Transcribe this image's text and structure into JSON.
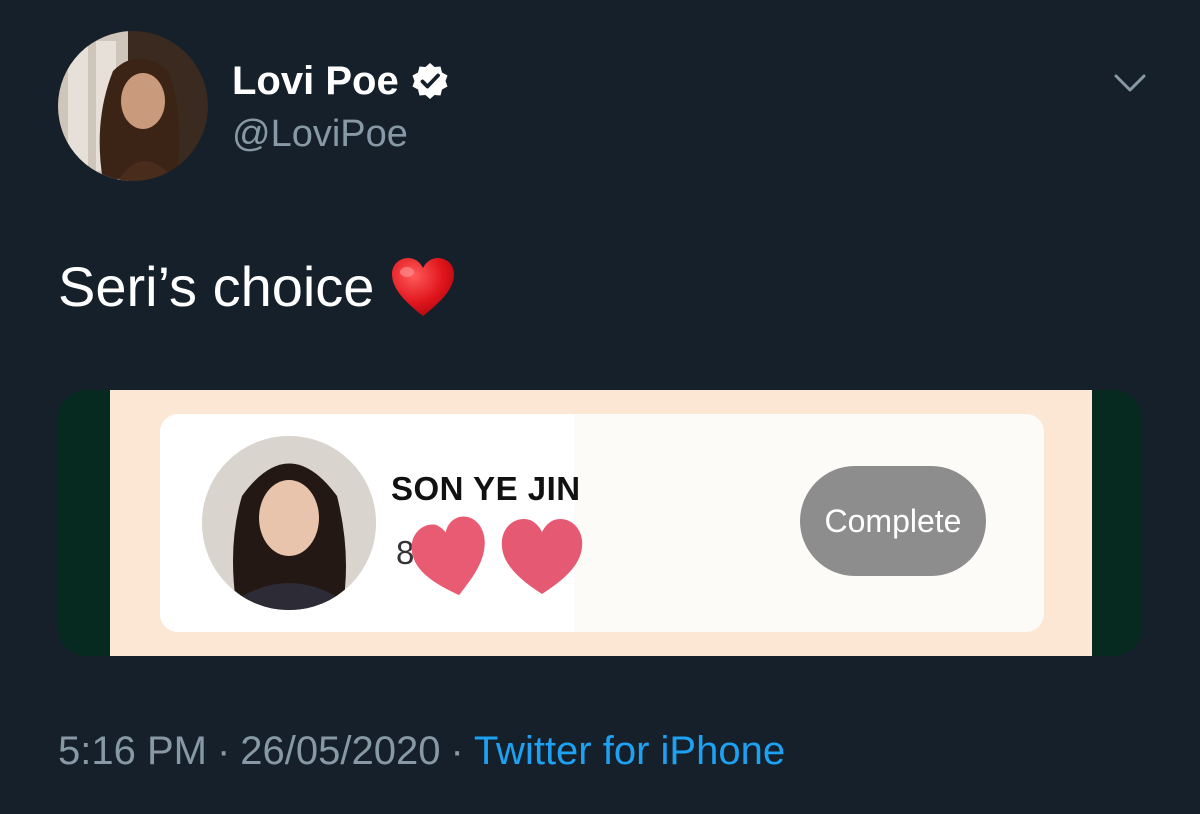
{
  "tweet": {
    "author": {
      "display_name": "Lovi Poe",
      "handle": "@LoviPoe",
      "verified": true,
      "avatar_icon": "profile-photo"
    },
    "text": "Seri’s choice",
    "emoji": "red-heart",
    "menu_icon": "chevron-down-icon",
    "media": {
      "card": {
        "name": "SON YE JIN",
        "score_visible_digit": "8",
        "button_label": "Complete",
        "stickers": "pink-heart-stickers"
      }
    },
    "meta": {
      "time": "5:16 PM",
      "separator": "·",
      "date": "26/05/2020",
      "source": "Twitter for iPhone"
    }
  },
  "colors": {
    "background": "#15202b",
    "primary_text": "#ffffff",
    "secondary_text": "#8899a6",
    "link": "#1da1f2",
    "heart": "#e0245e"
  }
}
